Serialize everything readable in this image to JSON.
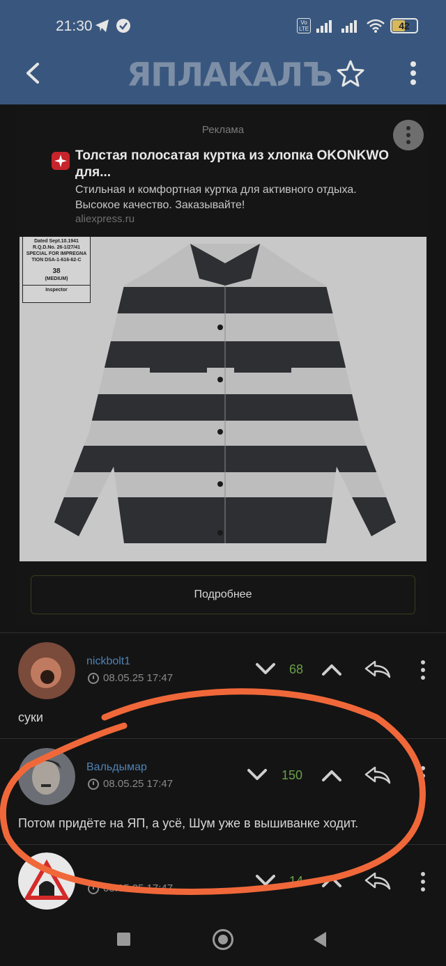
{
  "status_bar": {
    "time": "21:30",
    "volte": "Vo LTE",
    "battery": "42"
  },
  "header": {
    "logo": "ЯПЛАКАЛЪ"
  },
  "ad": {
    "label": "Реклама",
    "title": "Толстая полосатая куртка из хлопка OKONKWO для...",
    "description": "Стильная и комфортная куртка для активного отдыха. Высокое качество. Заказывайте!",
    "domain": "aliexpress.ru",
    "button": "Подробнее",
    "tag": {
      "line1": "Dated Sept.10.1941",
      "line2": "R.Q.D.No. 26-1/27/41",
      "line3": "SPECIAL FOR IMPREGNA",
      "line4": "TION DSA-1-616-62-C",
      "size": "38",
      "size_label": "(MEDIUM)",
      "inspector": "Inspector"
    }
  },
  "comments": [
    {
      "username": "nickbolt1",
      "datetime": "08.05.25 17:47",
      "score": "68",
      "text": "суки"
    },
    {
      "username": "Вальдымар",
      "datetime": "08.05.25 17:47",
      "score": "150",
      "text": "Потом придёте на ЯП, а усё, Шум уже в вышиванке ходит."
    },
    {
      "username": "",
      "datetime": "08.05.25 17:47",
      "score": "14",
      "text": ""
    }
  ],
  "colors": {
    "header_bg": "#39577e",
    "username": "#4f82b6",
    "score": "#6aa04a",
    "annotation": "#f0683a"
  },
  "icons": {
    "telegram": "telegram-icon",
    "check": "check-icon",
    "back": "arrow-left-icon",
    "star": "star-icon",
    "more": "more-vertical-icon",
    "down": "chevron-down-icon",
    "up": "chevron-up-icon",
    "reply": "reply-icon"
  }
}
